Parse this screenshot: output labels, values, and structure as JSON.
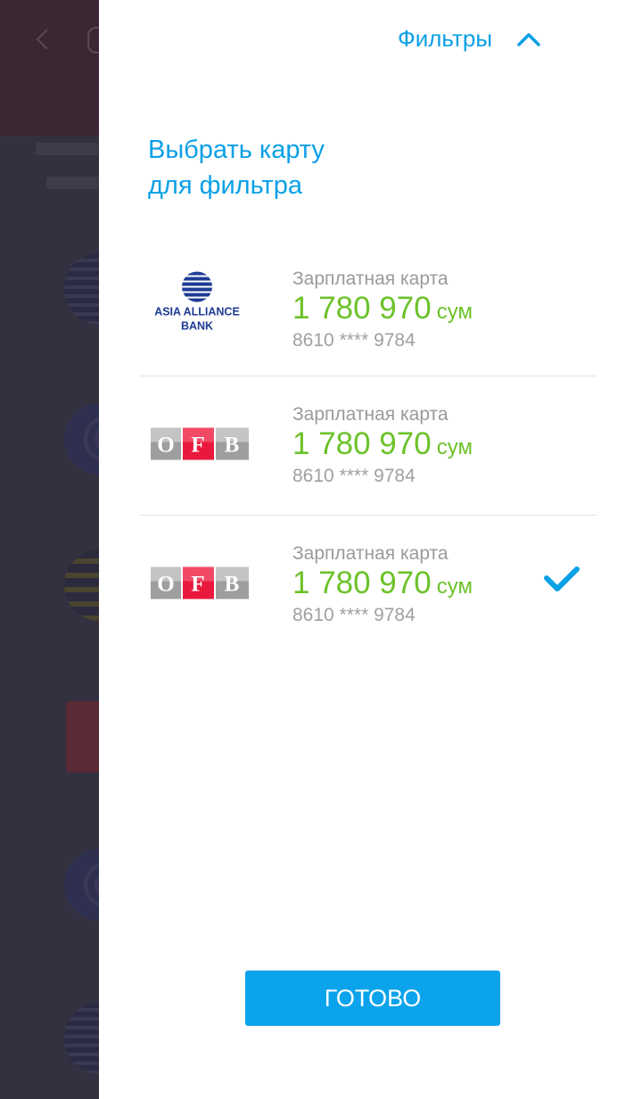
{
  "filter": {
    "title": "Фильтры",
    "toggle_icon": "chevron-up-icon"
  },
  "select": {
    "title_line1": "Выбрать карту",
    "title_line2": "для фильтра"
  },
  "cards": [
    {
      "bank_logo": "asia-alliance-bank-logo",
      "logo_text_1": "ASIA ALLIANCE",
      "logo_text_2": "BANK",
      "name": "Зарплатная карта",
      "balance": "1 780 970",
      "currency": "сум",
      "number": "8610 **** 9784",
      "selected": false
    },
    {
      "bank_logo": "ofb-logo",
      "logo_letters": [
        "O",
        "F",
        "B"
      ],
      "name": "Зарплатная карта",
      "balance": "1 780 970",
      "currency": "сум",
      "number": "8610 **** 9784",
      "selected": false
    },
    {
      "bank_logo": "ofb-logo",
      "logo_letters": [
        "O",
        "F",
        "B"
      ],
      "name": "Зарплатная карта",
      "balance": "1 780 970",
      "currency": "сум",
      "number": "8610 **** 9784",
      "selected": true
    }
  ],
  "done_button": {
    "label": "ГОТОВО"
  },
  "colors": {
    "accent": "#0aa0e6",
    "balance": "#6cc22a",
    "muted": "#9a9a9a",
    "ofb_red": "#e8193c",
    "ofb_gray": "#9e9e9e",
    "overlay": "#2f2c3d"
  }
}
